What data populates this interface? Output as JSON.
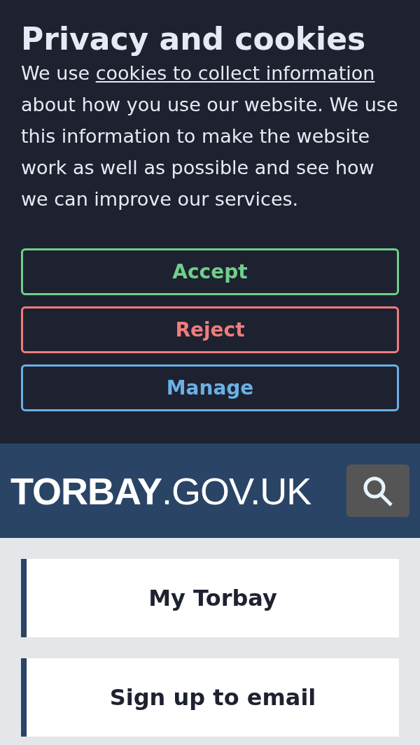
{
  "cookie_banner": {
    "title": "Privacy and cookies",
    "text_before": "We use ",
    "link": "cookies to collect information",
    "text_after": " about how you use our website. We use this information to make the website work as well as possible and see how we can improve our services.",
    "buttons": [
      {
        "label": "Accept",
        "color": "#6fcf8c"
      },
      {
        "label": "Reject",
        "color": "#f07c7c"
      },
      {
        "label": "Manage",
        "color": "#6ab0e6"
      }
    ]
  },
  "header": {
    "logo": "**TORBAY**.GOV.UK"
  },
  "menu": [
    {
      "label": "My Torbay"
    },
    {
      "label": "Sign up to email"
    }
  ]
}
